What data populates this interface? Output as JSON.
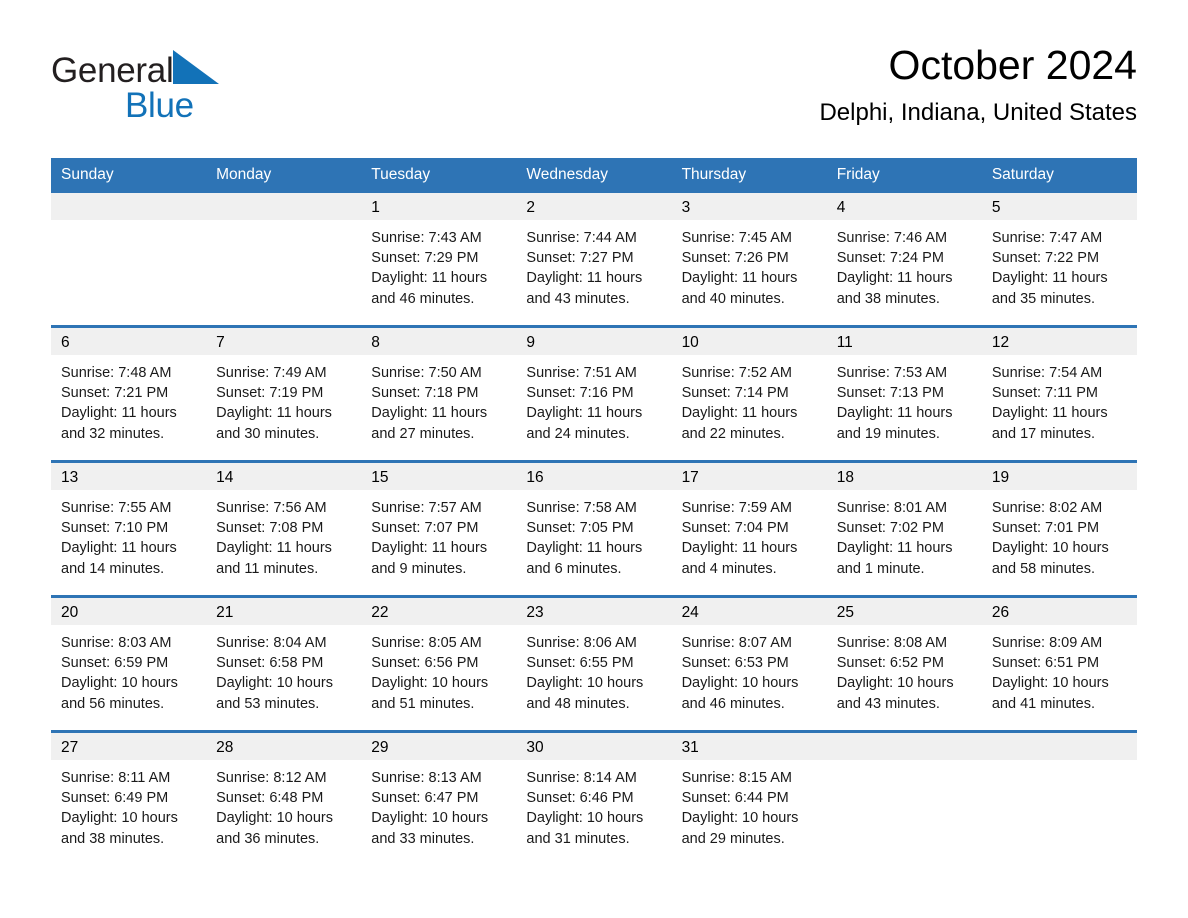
{
  "brand": {
    "name_part1": "General",
    "name_part2": "Blue",
    "logo_icon": "triangle-logo",
    "color_blue": "#1272b8",
    "color_dark": "#231f20"
  },
  "header": {
    "month_title": "October 2024",
    "location": "Delphi, Indiana, United States"
  },
  "theme": {
    "header_blue": "#2e74b5",
    "daynum_band": "#f0f0f0",
    "cell_background": "#ffffff"
  },
  "calendar": {
    "weekday_headers": [
      "Sunday",
      "Monday",
      "Tuesday",
      "Wednesday",
      "Thursday",
      "Friday",
      "Saturday"
    ],
    "weeks": [
      [
        {
          "day": "",
          "lines": []
        },
        {
          "day": "",
          "lines": []
        },
        {
          "day": "1",
          "lines": [
            "Sunrise: 7:43 AM",
            "Sunset: 7:29 PM",
            "Daylight: 11 hours and 46 minutes."
          ]
        },
        {
          "day": "2",
          "lines": [
            "Sunrise: 7:44 AM",
            "Sunset: 7:27 PM",
            "Daylight: 11 hours and 43 minutes."
          ]
        },
        {
          "day": "3",
          "lines": [
            "Sunrise: 7:45 AM",
            "Sunset: 7:26 PM",
            "Daylight: 11 hours and 40 minutes."
          ]
        },
        {
          "day": "4",
          "lines": [
            "Sunrise: 7:46 AM",
            "Sunset: 7:24 PM",
            "Daylight: 11 hours and 38 minutes."
          ]
        },
        {
          "day": "5",
          "lines": [
            "Sunrise: 7:47 AM",
            "Sunset: 7:22 PM",
            "Daylight: 11 hours and 35 minutes."
          ]
        }
      ],
      [
        {
          "day": "6",
          "lines": [
            "Sunrise: 7:48 AM",
            "Sunset: 7:21 PM",
            "Daylight: 11 hours and 32 minutes."
          ]
        },
        {
          "day": "7",
          "lines": [
            "Sunrise: 7:49 AM",
            "Sunset: 7:19 PM",
            "Daylight: 11 hours and 30 minutes."
          ]
        },
        {
          "day": "8",
          "lines": [
            "Sunrise: 7:50 AM",
            "Sunset: 7:18 PM",
            "Daylight: 11 hours and 27 minutes."
          ]
        },
        {
          "day": "9",
          "lines": [
            "Sunrise: 7:51 AM",
            "Sunset: 7:16 PM",
            "Daylight: 11 hours and 24 minutes."
          ]
        },
        {
          "day": "10",
          "lines": [
            "Sunrise: 7:52 AM",
            "Sunset: 7:14 PM",
            "Daylight: 11 hours and 22 minutes."
          ]
        },
        {
          "day": "11",
          "lines": [
            "Sunrise: 7:53 AM",
            "Sunset: 7:13 PM",
            "Daylight: 11 hours and 19 minutes."
          ]
        },
        {
          "day": "12",
          "lines": [
            "Sunrise: 7:54 AM",
            "Sunset: 7:11 PM",
            "Daylight: 11 hours and 17 minutes."
          ]
        }
      ],
      [
        {
          "day": "13",
          "lines": [
            "Sunrise: 7:55 AM",
            "Sunset: 7:10 PM",
            "Daylight: 11 hours and 14 minutes."
          ]
        },
        {
          "day": "14",
          "lines": [
            "Sunrise: 7:56 AM",
            "Sunset: 7:08 PM",
            "Daylight: 11 hours and 11 minutes."
          ]
        },
        {
          "day": "15",
          "lines": [
            "Sunrise: 7:57 AM",
            "Sunset: 7:07 PM",
            "Daylight: 11 hours and 9 minutes."
          ]
        },
        {
          "day": "16",
          "lines": [
            "Sunrise: 7:58 AM",
            "Sunset: 7:05 PM",
            "Daylight: 11 hours and 6 minutes."
          ]
        },
        {
          "day": "17",
          "lines": [
            "Sunrise: 7:59 AM",
            "Sunset: 7:04 PM",
            "Daylight: 11 hours and 4 minutes."
          ]
        },
        {
          "day": "18",
          "lines": [
            "Sunrise: 8:01 AM",
            "Sunset: 7:02 PM",
            "Daylight: 11 hours and 1 minute."
          ]
        },
        {
          "day": "19",
          "lines": [
            "Sunrise: 8:02 AM",
            "Sunset: 7:01 PM",
            "Daylight: 10 hours and 58 minutes."
          ]
        }
      ],
      [
        {
          "day": "20",
          "lines": [
            "Sunrise: 8:03 AM",
            "Sunset: 6:59 PM",
            "Daylight: 10 hours and 56 minutes."
          ]
        },
        {
          "day": "21",
          "lines": [
            "Sunrise: 8:04 AM",
            "Sunset: 6:58 PM",
            "Daylight: 10 hours and 53 minutes."
          ]
        },
        {
          "day": "22",
          "lines": [
            "Sunrise: 8:05 AM",
            "Sunset: 6:56 PM",
            "Daylight: 10 hours and 51 minutes."
          ]
        },
        {
          "day": "23",
          "lines": [
            "Sunrise: 8:06 AM",
            "Sunset: 6:55 PM",
            "Daylight: 10 hours and 48 minutes."
          ]
        },
        {
          "day": "24",
          "lines": [
            "Sunrise: 8:07 AM",
            "Sunset: 6:53 PM",
            "Daylight: 10 hours and 46 minutes."
          ]
        },
        {
          "day": "25",
          "lines": [
            "Sunrise: 8:08 AM",
            "Sunset: 6:52 PM",
            "Daylight: 10 hours and 43 minutes."
          ]
        },
        {
          "day": "26",
          "lines": [
            "Sunrise: 8:09 AM",
            "Sunset: 6:51 PM",
            "Daylight: 10 hours and 41 minutes."
          ]
        }
      ],
      [
        {
          "day": "27",
          "lines": [
            "Sunrise: 8:11 AM",
            "Sunset: 6:49 PM",
            "Daylight: 10 hours and 38 minutes."
          ]
        },
        {
          "day": "28",
          "lines": [
            "Sunrise: 8:12 AM",
            "Sunset: 6:48 PM",
            "Daylight: 10 hours and 36 minutes."
          ]
        },
        {
          "day": "29",
          "lines": [
            "Sunrise: 8:13 AM",
            "Sunset: 6:47 PM",
            "Daylight: 10 hours and 33 minutes."
          ]
        },
        {
          "day": "30",
          "lines": [
            "Sunrise: 8:14 AM",
            "Sunset: 6:46 PM",
            "Daylight: 10 hours and 31 minutes."
          ]
        },
        {
          "day": "31",
          "lines": [
            "Sunrise: 8:15 AM",
            "Sunset: 6:44 PM",
            "Daylight: 10 hours and 29 minutes."
          ]
        },
        {
          "day": "",
          "lines": []
        },
        {
          "day": "",
          "lines": []
        }
      ]
    ]
  }
}
